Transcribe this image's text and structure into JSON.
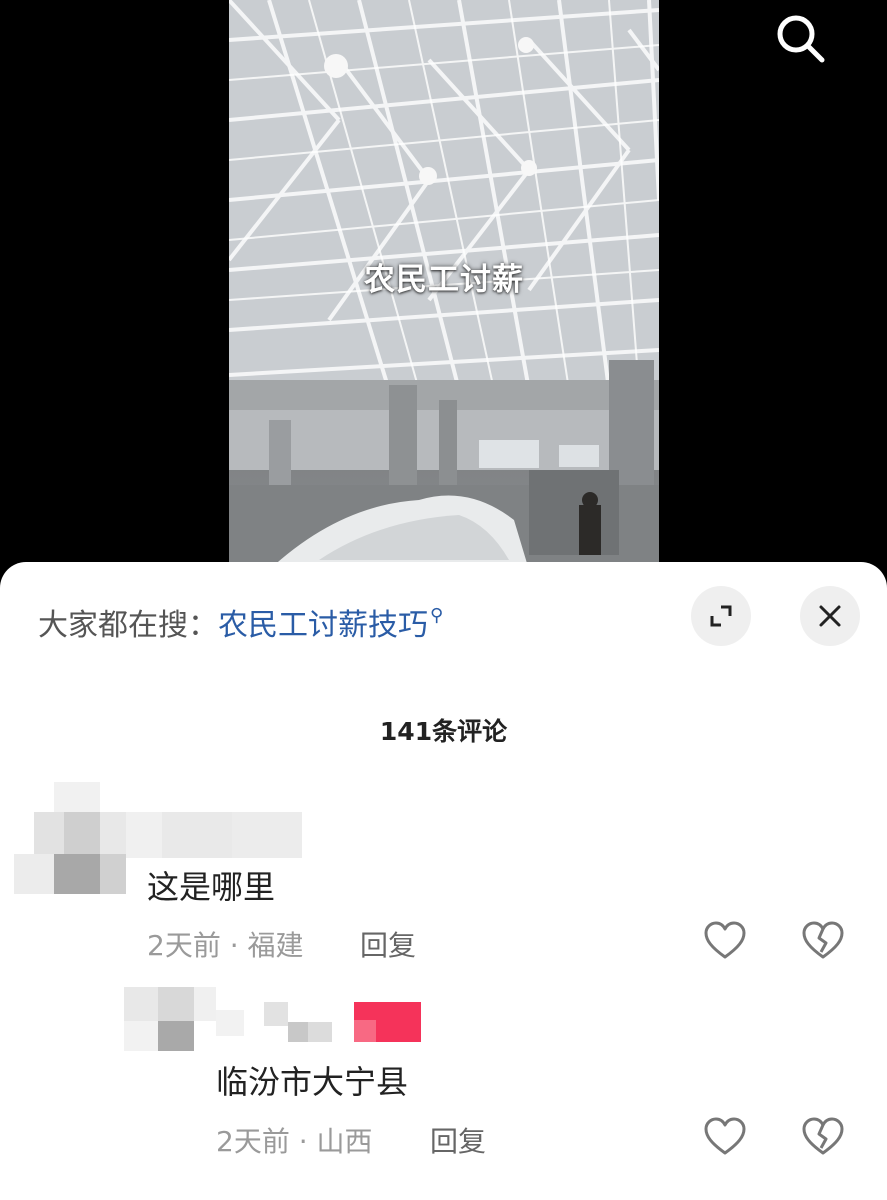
{
  "video": {
    "caption": "农民工讨薪"
  },
  "sheet": {
    "hot_search_prefix": "大家都在搜：",
    "hot_search_query": "农民工讨薪技巧",
    "comment_count": "141条评论"
  },
  "comments": [
    {
      "text": "这是哪里",
      "time": "2天前",
      "location": "福建",
      "reply_label": "回复"
    },
    {
      "text": "临汾市大宁县",
      "time": "2天前",
      "location": "山西",
      "reply_label": "回复"
    }
  ],
  "colors": {
    "link": "#2a5ca6",
    "badge": "#f5335a"
  },
  "icons": {
    "search": "search-icon",
    "expand": "expand-icon",
    "close": "close-icon",
    "like": "heart-icon",
    "dislike": "broken-heart-icon"
  }
}
